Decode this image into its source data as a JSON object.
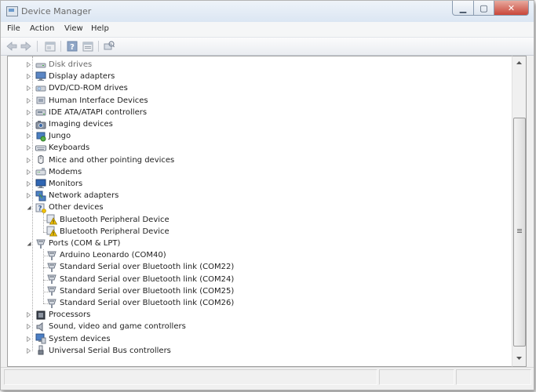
{
  "window": {
    "title": "Device Manager"
  },
  "caption_buttons": {
    "minimize": "▁",
    "maximize": "▢",
    "close": "✕"
  },
  "menu": [
    "File",
    "Action",
    "View",
    "Help"
  ],
  "toolbar": [
    "back-arrow-icon",
    "forward-arrow-icon",
    "properties-icon",
    "help-icon",
    "show-hidden-icon",
    "scan-hardware-icon"
  ],
  "tree": [
    {
      "label": "Disk drives",
      "icon": "disk-drive-icon",
      "level": 0,
      "expanded": false,
      "greyed": true
    },
    {
      "label": "Display adapters",
      "icon": "display-adapter-icon",
      "level": 0,
      "expanded": false
    },
    {
      "label": "DVD/CD-ROM drives",
      "icon": "dvd-drive-icon",
      "level": 0,
      "expanded": false
    },
    {
      "label": "Human Interface Devices",
      "icon": "hid-icon",
      "level": 0,
      "expanded": false
    },
    {
      "label": "IDE ATA/ATAPI controllers",
      "icon": "ide-controller-icon",
      "level": 0,
      "expanded": false
    },
    {
      "label": "Imaging devices",
      "icon": "camera-icon",
      "level": 0,
      "expanded": false
    },
    {
      "label": "Jungo",
      "icon": "jungo-icon",
      "level": 0,
      "expanded": false
    },
    {
      "label": "Keyboards",
      "icon": "keyboard-icon",
      "level": 0,
      "expanded": false
    },
    {
      "label": "Mice and other pointing devices",
      "icon": "mouse-icon",
      "level": 0,
      "expanded": false
    },
    {
      "label": "Modems",
      "icon": "modem-icon",
      "level": 0,
      "expanded": false
    },
    {
      "label": "Monitors",
      "icon": "monitor-icon",
      "level": 0,
      "expanded": false
    },
    {
      "label": "Network adapters",
      "icon": "network-adapter-icon",
      "level": 0,
      "expanded": false
    },
    {
      "label": "Other devices",
      "icon": "other-devices-icon",
      "level": 0,
      "expanded": true
    },
    {
      "label": "Bluetooth Peripheral Device",
      "icon": "warning-device-icon",
      "level": 1
    },
    {
      "label": "Bluetooth Peripheral Device",
      "icon": "warning-device-icon",
      "level": 1
    },
    {
      "label": "Ports (COM & LPT)",
      "icon": "port-icon",
      "level": 0,
      "expanded": true
    },
    {
      "label": "Arduino Leonardo (COM40)",
      "icon": "port-icon",
      "level": 1
    },
    {
      "label": "Standard Serial over Bluetooth link (COM22)",
      "icon": "port-icon",
      "level": 1
    },
    {
      "label": "Standard Serial over Bluetooth link (COM24)",
      "icon": "port-icon",
      "level": 1
    },
    {
      "label": "Standard Serial over Bluetooth link (COM25)",
      "icon": "port-icon",
      "level": 1
    },
    {
      "label": "Standard Serial over Bluetooth link (COM26)",
      "icon": "port-icon",
      "level": 1
    },
    {
      "label": "Processors",
      "icon": "processor-icon",
      "level": 0,
      "expanded": false
    },
    {
      "label": "Sound, video and game controllers",
      "icon": "speaker-icon",
      "level": 0,
      "expanded": false
    },
    {
      "label": "System devices",
      "icon": "system-devices-icon",
      "level": 0,
      "expanded": false
    },
    {
      "label": "Universal Serial Bus controllers",
      "icon": "usb-icon",
      "level": 0,
      "expanded": false
    }
  ],
  "colors": {
    "accent": "#3a6fb0",
    "warning": "#f2c200",
    "tree_lines": "#a8a8a8"
  }
}
